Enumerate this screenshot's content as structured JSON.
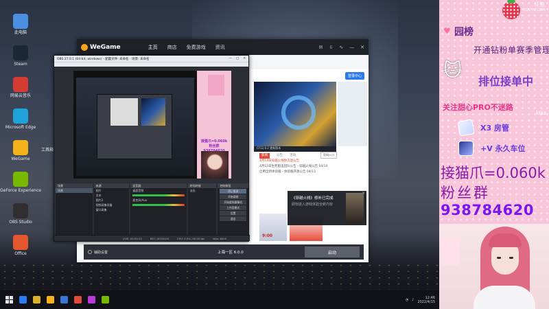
{
  "desktop": {
    "icons": [
      {
        "label": "此电脑",
        "color": "#4b8fe2"
      },
      {
        "label": "Steam",
        "color": "#1b2838"
      },
      {
        "label": "网易云音乐",
        "color": "#d43c33"
      },
      {
        "label": "Microsoft Edge",
        "color": "#1fa2d9"
      },
      {
        "label": "WeGame",
        "color": "#f6b21b"
      },
      {
        "label": "GeForce Experience",
        "color": "#76b900"
      },
      {
        "label": "OBS Studio",
        "color": "#302e31"
      },
      {
        "label": "Office",
        "color": "#e4572e"
      }
    ],
    "mid_label": "工具箱"
  },
  "wegame": {
    "logo": "WeGame",
    "nav": [
      "主页",
      "商店",
      "免费游戏",
      "资讯"
    ],
    "login": "登录中心",
    "banner_caption": "CF12.6.2 更新版本",
    "news_tabs": [
      "新闻",
      "公告",
      "活动"
    ],
    "news_headline": "4月14日穿越火线防沉迷公告",
    "news_lines": [
      "4月15日生死狙击团队公告 - 穿越火线公告",
      "启用全新体验服 - 体验服开放公告"
    ],
    "news_dates": [
      "04/14",
      "04/13"
    ],
    "download_link": "官网入口",
    "promo_number": "9:00",
    "notice_title": "《穿越火线》修补已完成",
    "notice_sub": "即刻进入游戏体验全新内容",
    "bottom_label": "辅助设置",
    "version": "上海一区 6.0.0",
    "launch": "启动"
  },
  "obs": {
    "title": "OBS 27.0.1 (64-bit, windows) - 配置文件: 未命名 - 场景: 未命名",
    "preview_num_a": "接猫爪=0.060k",
    "preview_num_b": "粉丝群",
    "preview_num_c": "938784620",
    "docks": {
      "scenes_header": "场景",
      "scenes": [
        "场景"
      ],
      "sources_header": "来源",
      "sources": [
        "图片",
        "文本",
        "图片2",
        "视频采集设备",
        "窗口采集"
      ],
      "mixer_header": "混音器",
      "mixer_tracks": [
        "桌面音频",
        "麦克风/Aux"
      ],
      "transitions_header": "转场特效",
      "transition": "淡出",
      "controls_header": "控制按钮",
      "controls": [
        "停止推流",
        "开始录制",
        "开始虚拟摄像机",
        "工作室模式",
        "设置",
        "退出"
      ]
    },
    "status": [
      "LIVE: 00:50:22",
      "REC: 00:00:00",
      "CPU: 4.5%, 60.00 fps",
      "kb/s: 6000"
    ]
  },
  "taskbar": {
    "icon_colors": [
      "#2b7cf0",
      "#d8b12a",
      "#f6b21b",
      "#3a76d6",
      "#e24b3b",
      "#b93ad6",
      "#76b900"
    ],
    "clock_time": "12:46",
    "clock_date": "2022/4/15"
  },
  "panel": {
    "watermark_main": "斗鱼",
    "watermark_sub": "DOUYU.COM",
    "title": "园榜",
    "banner": "开通钻粉单赛季管理",
    "order_text": "排位接单中",
    "follow_text": "关注甜心PRO不迷路",
    "kiss": "kiss",
    "row1_text": "X3 房管",
    "row2_text": "+V 永久车位",
    "claw_text": "接猫爪=0.060k",
    "fans_label": "粉丝群",
    "fans_number": "938784620"
  }
}
